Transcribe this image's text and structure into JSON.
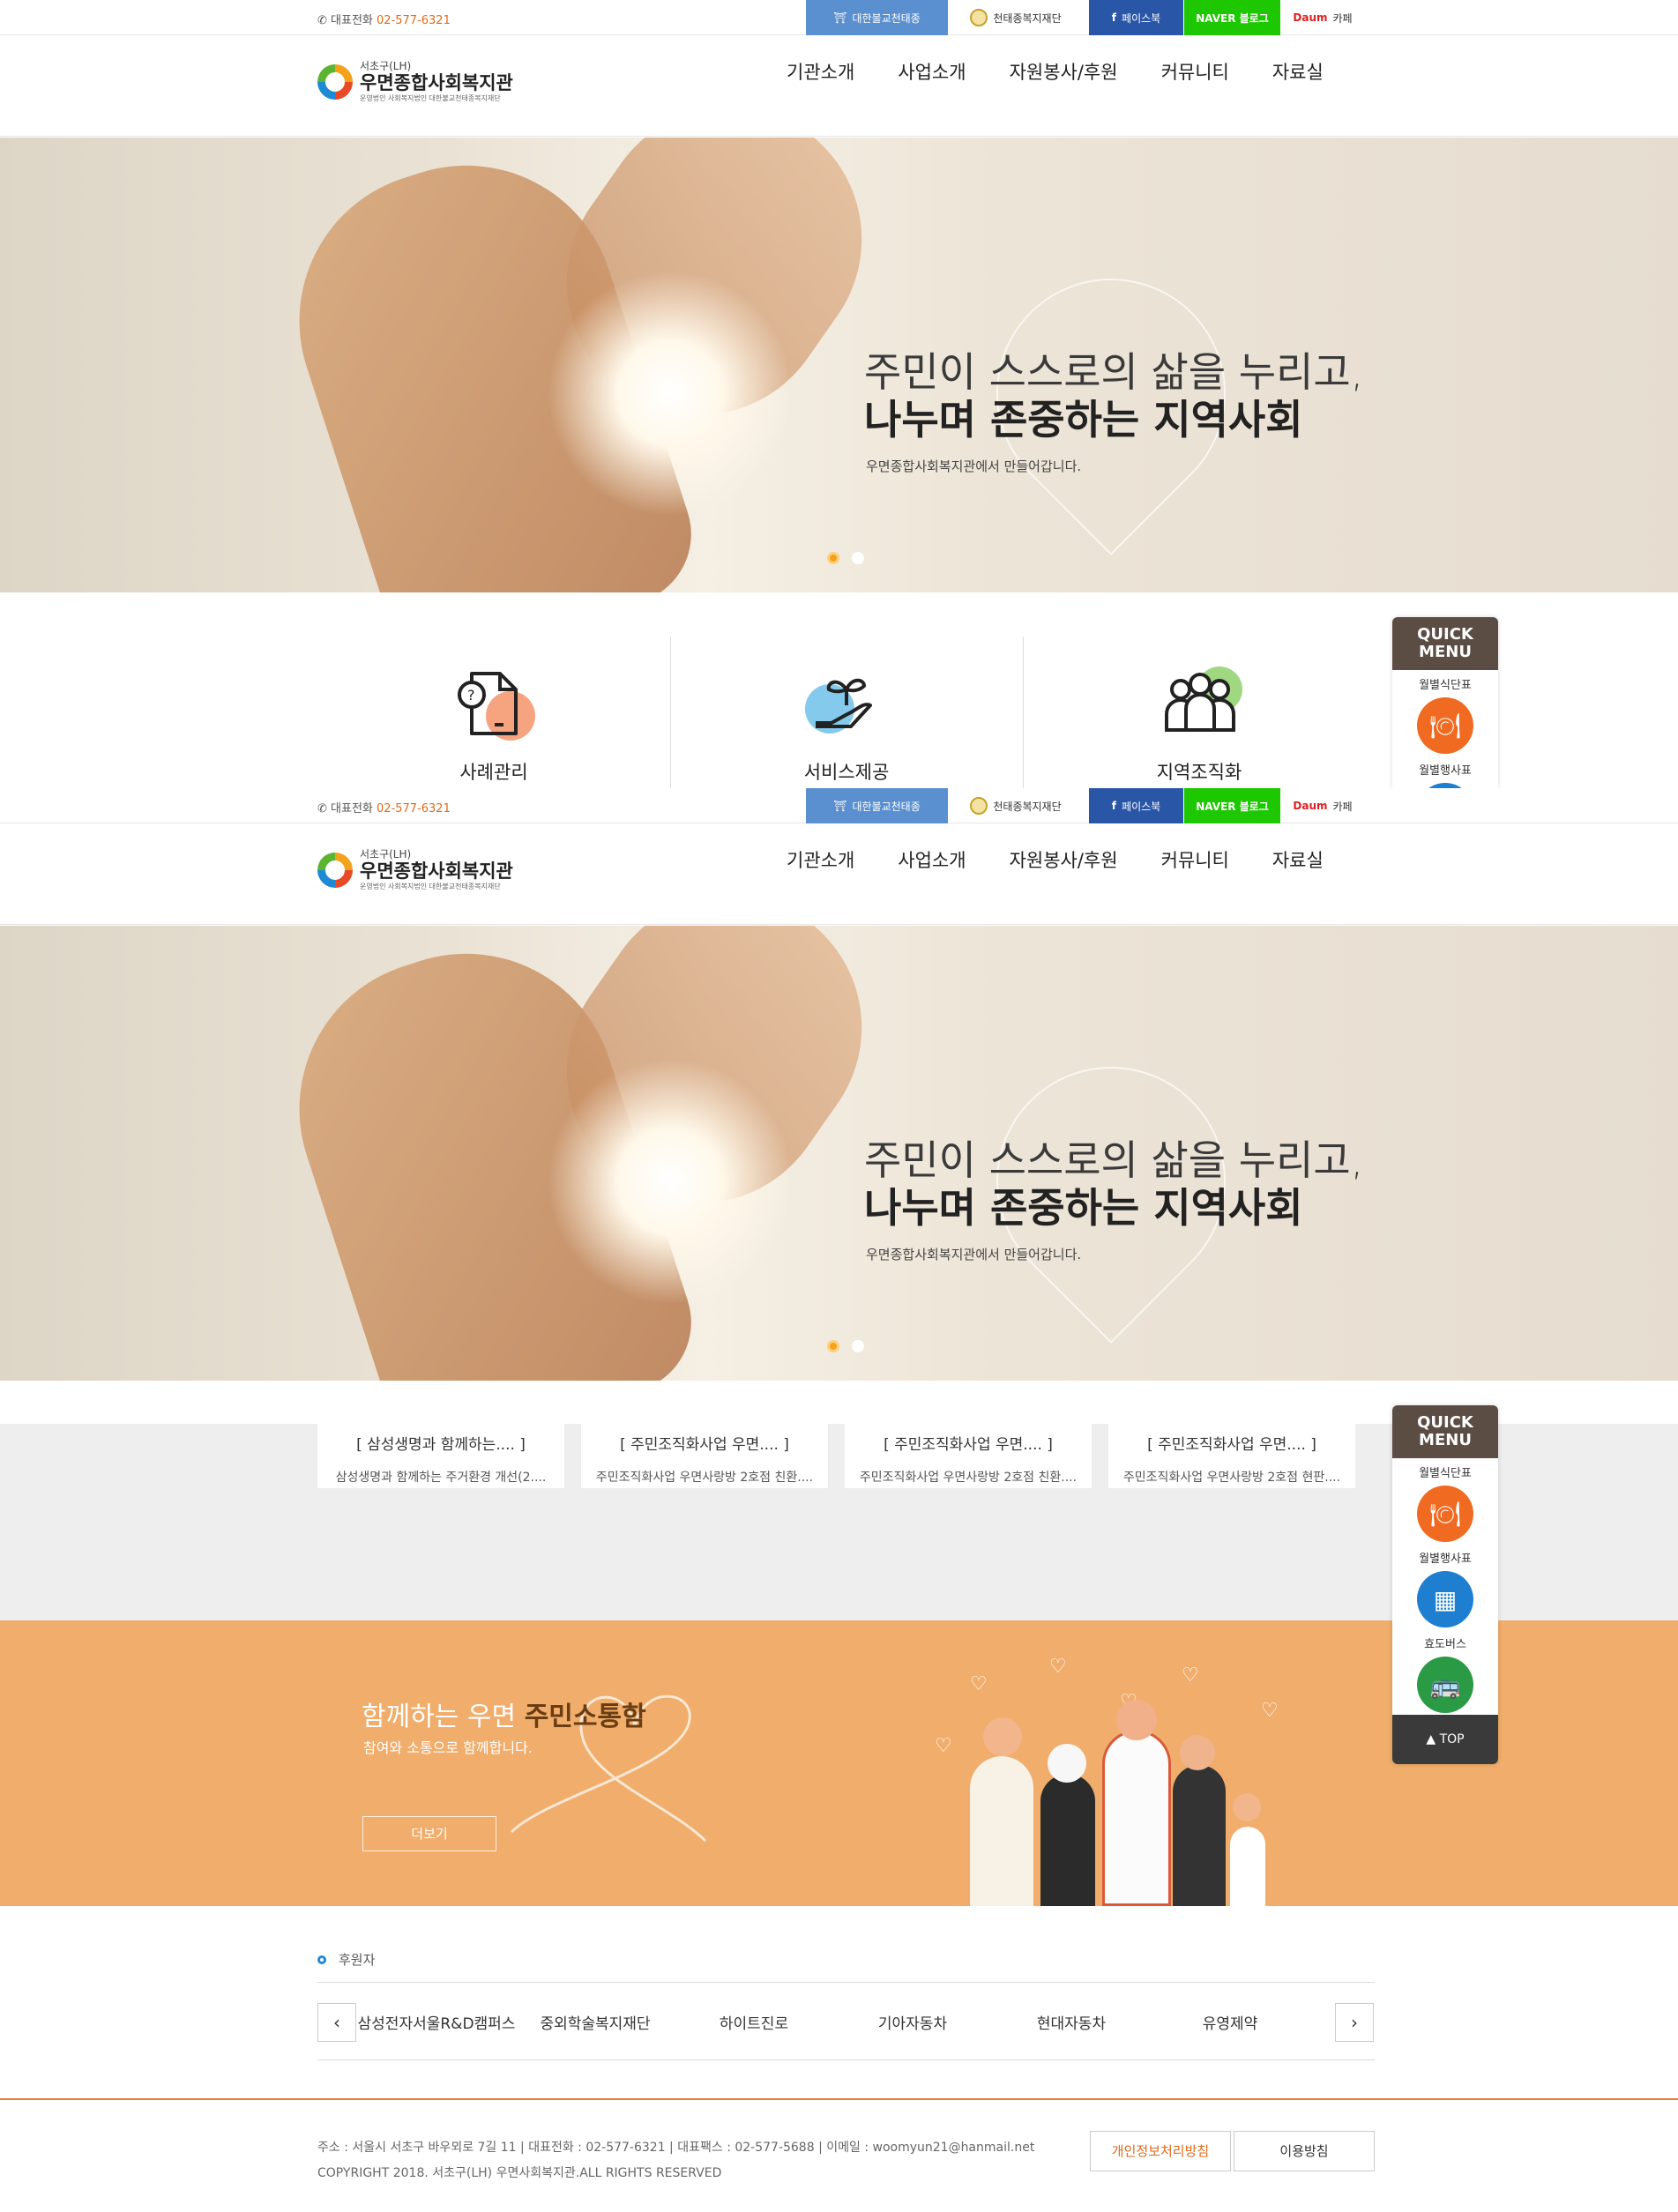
{
  "topbar": {
    "phone_label": "대표전화",
    "phone_number": "02-577-6321",
    "links": [
      "대한불교천태종",
      "천태종복지재단",
      "페이스북",
      "NAVER 블로그",
      "카페"
    ],
    "facebook_glyph": "f",
    "daum_logo": "Daum"
  },
  "logo": {
    "sub": "서초구(LH)",
    "name": "우면종합사회복지관",
    "operator": "운영법인 사회복지법인 대한불교천태종복지재단"
  },
  "nav": [
    "기관소개",
    "사업소개",
    "자원봉사/후원",
    "커뮤니티",
    "자료실"
  ],
  "hero": {
    "line1": "주민이 스스로의 삶을 누리고,",
    "line2": "나누며 존중하는 지역사회",
    "line3": "우면종합사회복지관에서 만들어갑니다."
  },
  "services": [
    {
      "label": "사례관리",
      "icon": "case-document-icon",
      "accent": "#f5936a"
    },
    {
      "label": "서비스제공",
      "icon": "hand-sprout-icon",
      "accent": "#6ec1ea"
    },
    {
      "label": "지역조직화",
      "icon": "people-group-icon",
      "accent": "#8ed16b"
    }
  ],
  "quick_menu": {
    "title_line1": "QUICK",
    "title_line2": "MENU",
    "items": [
      {
        "label": "월별식단표",
        "icon": "meal-icon",
        "color": "#f06a21"
      },
      {
        "label": "월별행사표",
        "icon": "calendar-icon",
        "color": "#1e7fd0"
      },
      {
        "label": "효도버스",
        "icon": "bus-icon",
        "color": "#2a9a45"
      }
    ],
    "top_label": "TOP"
  },
  "news": [
    {
      "title": "[ 삼성생명과 함께하는.... ]",
      "desc": "삼성생명과 함께하는 주거환경 개선(2...."
    },
    {
      "title": "[ 주민조직화사업 우면.... ]",
      "desc": "주민조직화사업 우면사랑방 2호점 친환...."
    },
    {
      "title": "[ 주민조직화사업 우면.... ]",
      "desc": "주민조직화사업 우면사랑방 2호점 친환...."
    },
    {
      "title": "[ 주민조직화사업 우면.... ]",
      "desc": "주민조직화사업 우면사랑방 2호점 현판...."
    }
  ],
  "banner": {
    "title_part1": "함께하는 우면 ",
    "title_part2": "주민소통함",
    "sub": "참여와 소통으로 함께합니다.",
    "button": "더보기"
  },
  "sponsors": {
    "title": "후원자",
    "items": [
      "삼성전자서울R&D캠퍼스",
      "중외학술복지재단",
      "하이트진로",
      "기아자동차",
      "현대자동차",
      "유영제약"
    ],
    "prev": "‹",
    "next": "›"
  },
  "footer": {
    "address": "주소 : 서울시 서초구 바우뫼로 7길 11  |  대표전화 : 02-577-6321  |  대표팩스 : 02-577-5688  |  이메일 : woomyun21@hanmail.net",
    "copyright": "COPYRIGHT 2018. 서초구(LH) 우면사회복지관.ALL RIGHTS RESERVED",
    "privacy": "개인정보처리방침",
    "terms": "이용방침"
  },
  "colors": {
    "accent_orange": "#e06a1a",
    "banner_bg": "#f0ad6b",
    "quick_head": "#5b4c44"
  }
}
